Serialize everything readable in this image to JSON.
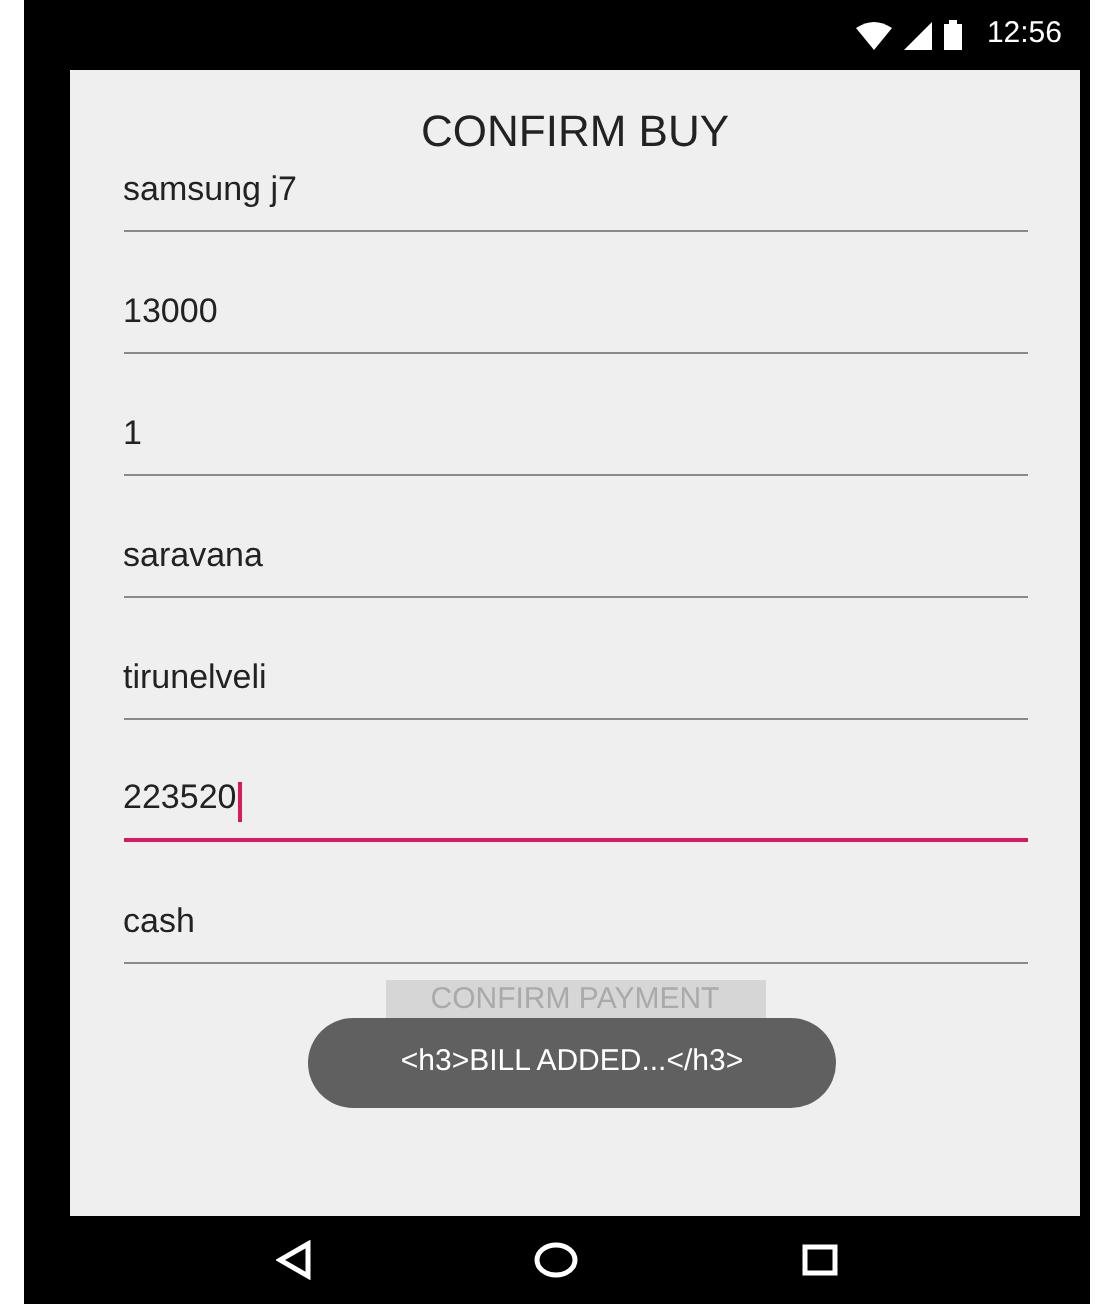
{
  "status_bar": {
    "time": "12:56"
  },
  "title": "CONFIRM BUY",
  "fields": [
    {
      "value": "samsung j7",
      "focused": false
    },
    {
      "value": "13000",
      "focused": false
    },
    {
      "value": "1",
      "focused": false
    },
    {
      "value": "saravana",
      "focused": false
    },
    {
      "value": "tirunelveli",
      "focused": false
    },
    {
      "value": "223520",
      "focused": true
    },
    {
      "value": "cash",
      "focused": false
    }
  ],
  "button": {
    "label": "CONFIRM PAYMENT"
  },
  "toast": {
    "text": "<h3>BILL ADDED...</h3>"
  }
}
